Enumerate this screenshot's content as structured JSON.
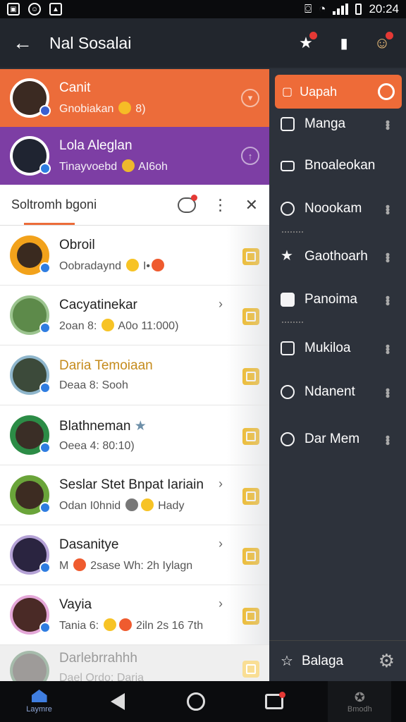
{
  "status_bar": {
    "time": "20:24"
  },
  "app_bar": {
    "title": "Nal Sosalai"
  },
  "highlighted": [
    {
      "name": "Canit",
      "subtitle": "Gnobiakan",
      "subtitle_tail": "8)",
      "color": "#ec6c3a",
      "face": "#3b2a22"
    },
    {
      "name": "Lola Aleglan",
      "subtitle": "Tinayvoebd",
      "subtitle_tail": "AI6oh",
      "color": "#7d3ea4",
      "face": "#1f2431"
    }
  ],
  "section": {
    "label": "Soltromh bgoni"
  },
  "contacts": [
    {
      "name": "Obroil",
      "subtitle": "Oobradaynd",
      "subtitle_tail": "I•",
      "face": "#f2a21b",
      "chevron": false,
      "gold": false
    },
    {
      "name": "Cacyatinekar",
      "subtitle": "2oan 8:",
      "subtitle_tail": "A0o 11:000)",
      "face": "#5d8a4a",
      "chevron": true,
      "gold": false
    },
    {
      "name": "Daria Temoiaan",
      "subtitle": "Deaa 8: Sooh",
      "subtitle_tail": "",
      "face": "#3c7a9a",
      "chevron": false,
      "gold": true
    },
    {
      "name": "Blathneman",
      "subtitle": "Oeea 4: 80:10)",
      "subtitle_tail": "",
      "face": "#2c8c46",
      "chevron": false,
      "gold": false
    },
    {
      "name": "Seslar Stet Bnpat Iariain",
      "subtitle": "Odan I0hnid",
      "subtitle_tail": "Hady",
      "face": "#6aa43a",
      "chevron": true,
      "gold": false
    },
    {
      "name": "Dasanitye",
      "subtitle": "M",
      "subtitle_tail": "2sase Wh: 2h Iylagn",
      "face": "#3f4f9a",
      "chevron": true,
      "gold": false
    },
    {
      "name": "Vayia",
      "subtitle": "Tania 6:",
      "subtitle_tail": "2iln 2s 16 7th",
      "face": "#b04aa3",
      "chevron": true,
      "gold": false
    },
    {
      "name": "Darlebrrahhh",
      "subtitle": "Dael Ordo: Daria",
      "subtitle_tail": "",
      "face": "#3c6b46",
      "chevron": false,
      "gold": false
    }
  ],
  "drawer": {
    "active": "Uapah",
    "items": [
      {
        "label": "Manga",
        "icon": "people-icon",
        "more": true
      },
      {
        "label": "Bnoaleokan",
        "icon": "mail-icon",
        "more": false
      },
      {
        "label": "Noookam",
        "icon": "shield-icon",
        "more": true
      },
      {
        "label": "Gaothoarh",
        "icon": "star-icon",
        "more": true
      },
      {
        "label": "Panoima",
        "icon": "file-icon",
        "more": true
      },
      {
        "label": "Mukiloa",
        "icon": "book-icon",
        "more": true
      },
      {
        "label": "Ndanent",
        "icon": "pin-icon",
        "more": true
      },
      {
        "label": "Dar Mem",
        "icon": "clock-icon",
        "more": true
      }
    ],
    "bottom": "Balaga"
  },
  "nav": {
    "home_label": "Laymre",
    "last_label": "Bmodh"
  },
  "colors": {
    "accent": "#ec6c3a",
    "purple": "#7d3ea4",
    "drawer": "#2d323b",
    "badge": "#f3b815"
  }
}
